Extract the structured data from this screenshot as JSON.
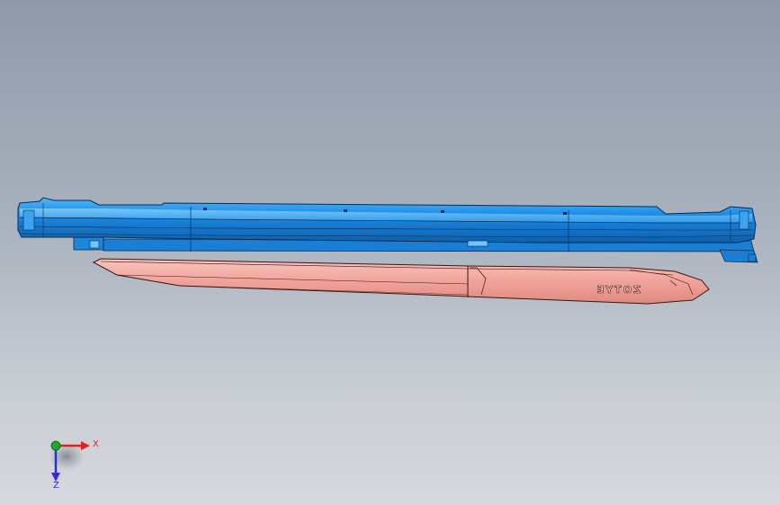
{
  "viewport": {
    "background_top": "#8f9aaa",
    "background_bottom": "#d6d9dd"
  },
  "parts": {
    "mold_body": {
      "color": "#1f8ee6",
      "edge_color": "#0a2a52"
    },
    "trim_panel": {
      "color": "#f2a8a0",
      "edge_color": "#3a1410",
      "emboss_text": "ZOTYE"
    }
  },
  "triad": {
    "x_label": "X",
    "z_label": "Z",
    "x_color": "#e0231b",
    "y_color": "#1fa82a",
    "z_color": "#2a2fd6"
  }
}
